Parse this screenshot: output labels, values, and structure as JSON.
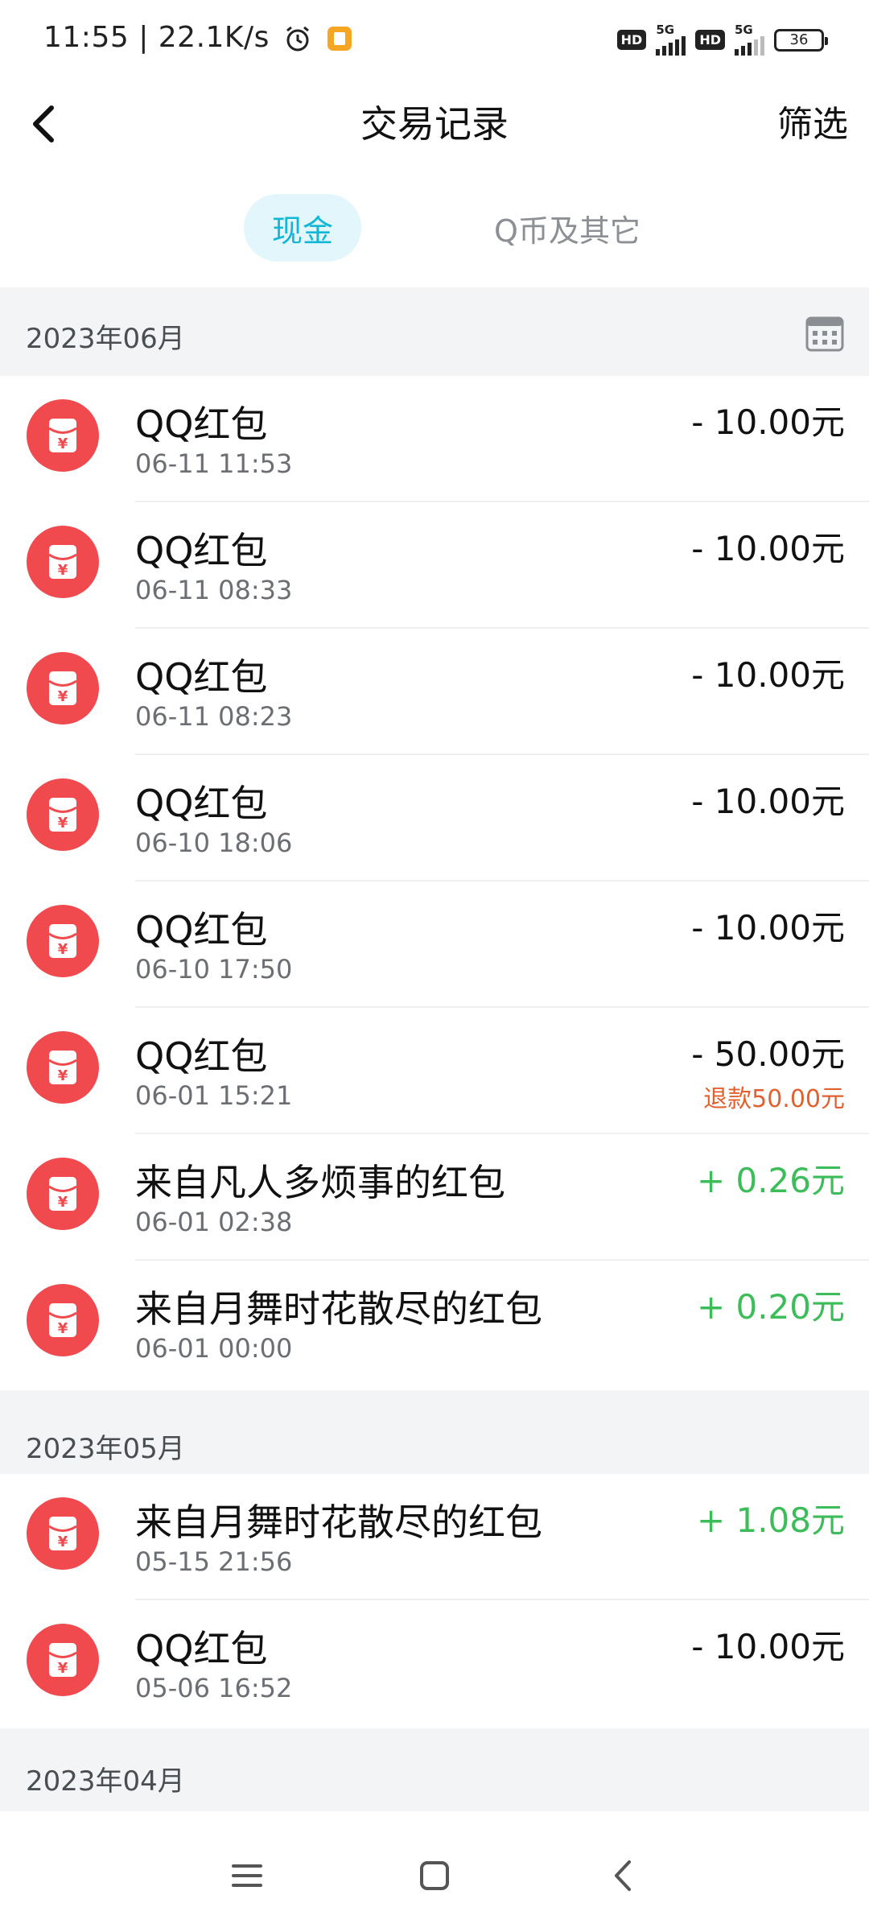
{
  "status_bar": {
    "text": "11:55 | 22.1K/s",
    "hd1": "HD",
    "net1": "5G",
    "hd2": "HD",
    "net2": "5G",
    "battery": "36"
  },
  "header": {
    "title": "交易记录",
    "filter_label": "筛选"
  },
  "tabs": {
    "cash": "现金",
    "qcoin": "Q币及其它"
  },
  "sections": [
    {
      "label": "2023年06月"
    },
    {
      "label": "2023年05月"
    },
    {
      "label": "2023年04月"
    }
  ],
  "transactions": [
    {
      "name": "QQ红包",
      "time": "06-11 11:53",
      "amount": "- 10.00元"
    },
    {
      "name": "QQ红包",
      "time": "06-11 08:33",
      "amount": "- 10.00元"
    },
    {
      "name": "QQ红包",
      "time": "06-11 08:23",
      "amount": "- 10.00元"
    },
    {
      "name": "QQ红包",
      "time": "06-10 18:06",
      "amount": "- 10.00元"
    },
    {
      "name": "QQ红包",
      "time": "06-10 17:50",
      "amount": "- 10.00元"
    },
    {
      "name": "QQ红包",
      "time": "06-01 15:21",
      "amount": "- 50.00元",
      "refund": "退款50.00元"
    },
    {
      "name": "来自凡人多烦事的红包",
      "time": "06-01 02:38",
      "amount": "+ 0.26元"
    },
    {
      "name": "来自月舞时花散尽的红包",
      "time": "06-01 00:00",
      "amount": "+ 0.20元"
    },
    {
      "name": "来自月舞时花散尽的红包",
      "time": "05-15 21:56",
      "amount": "+ 1.08元"
    },
    {
      "name": "QQ红包",
      "time": "05-06 16:52",
      "amount": "- 10.00元"
    }
  ],
  "colors": {
    "accent": "#12b7d8",
    "income": "#3cbd5a",
    "refund": "#e2602f",
    "red_packet": "#f04a4f"
  },
  "icons": {
    "back": "chevron-left-icon",
    "calendar": "calendar-icon",
    "red_packet": "red-packet-icon",
    "nav_menu": "menu-icon",
    "nav_home": "home-square-icon",
    "nav_back": "back-triangle-icon"
  }
}
